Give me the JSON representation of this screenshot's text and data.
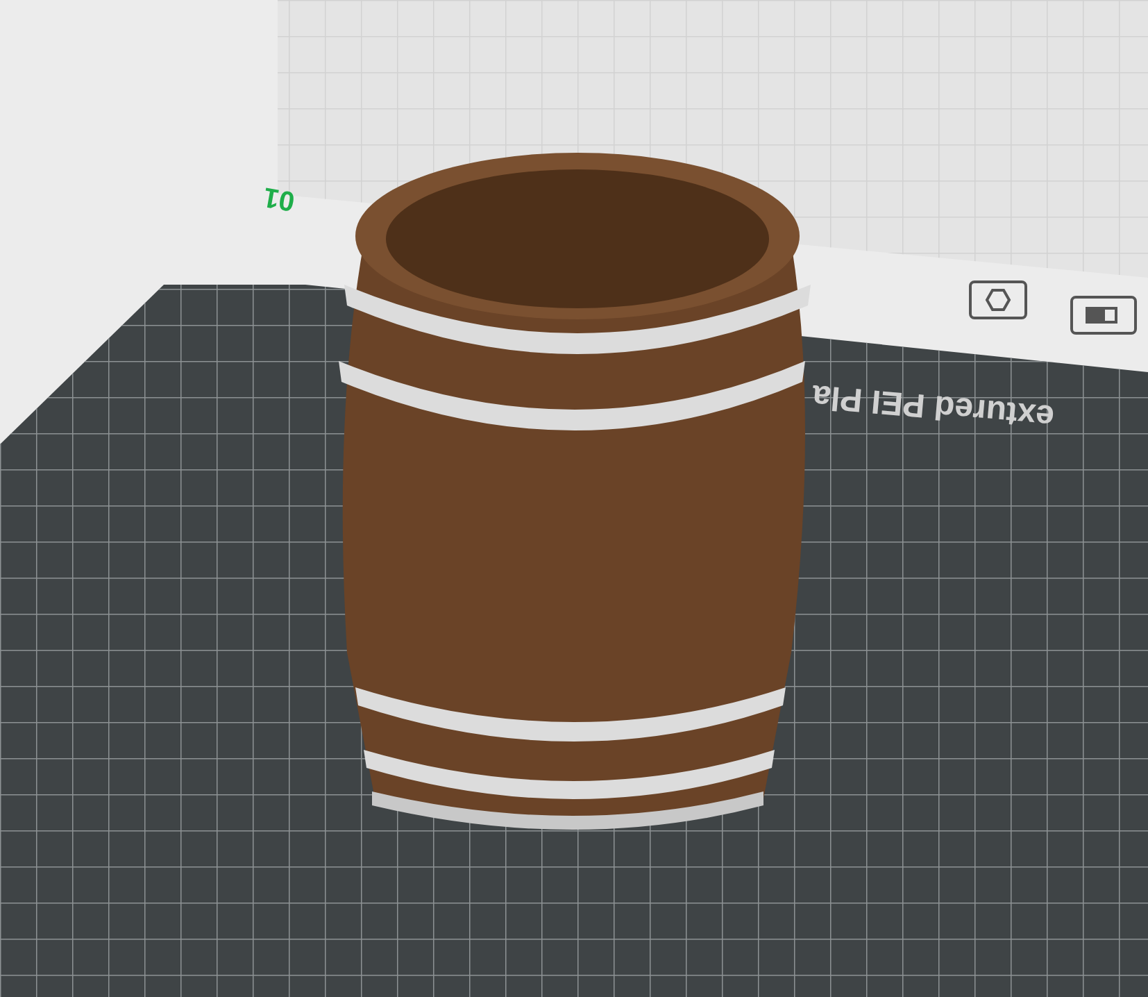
{
  "viewport": {
    "plate_number": "01",
    "plate_type": "extured PEI Pla"
  }
}
